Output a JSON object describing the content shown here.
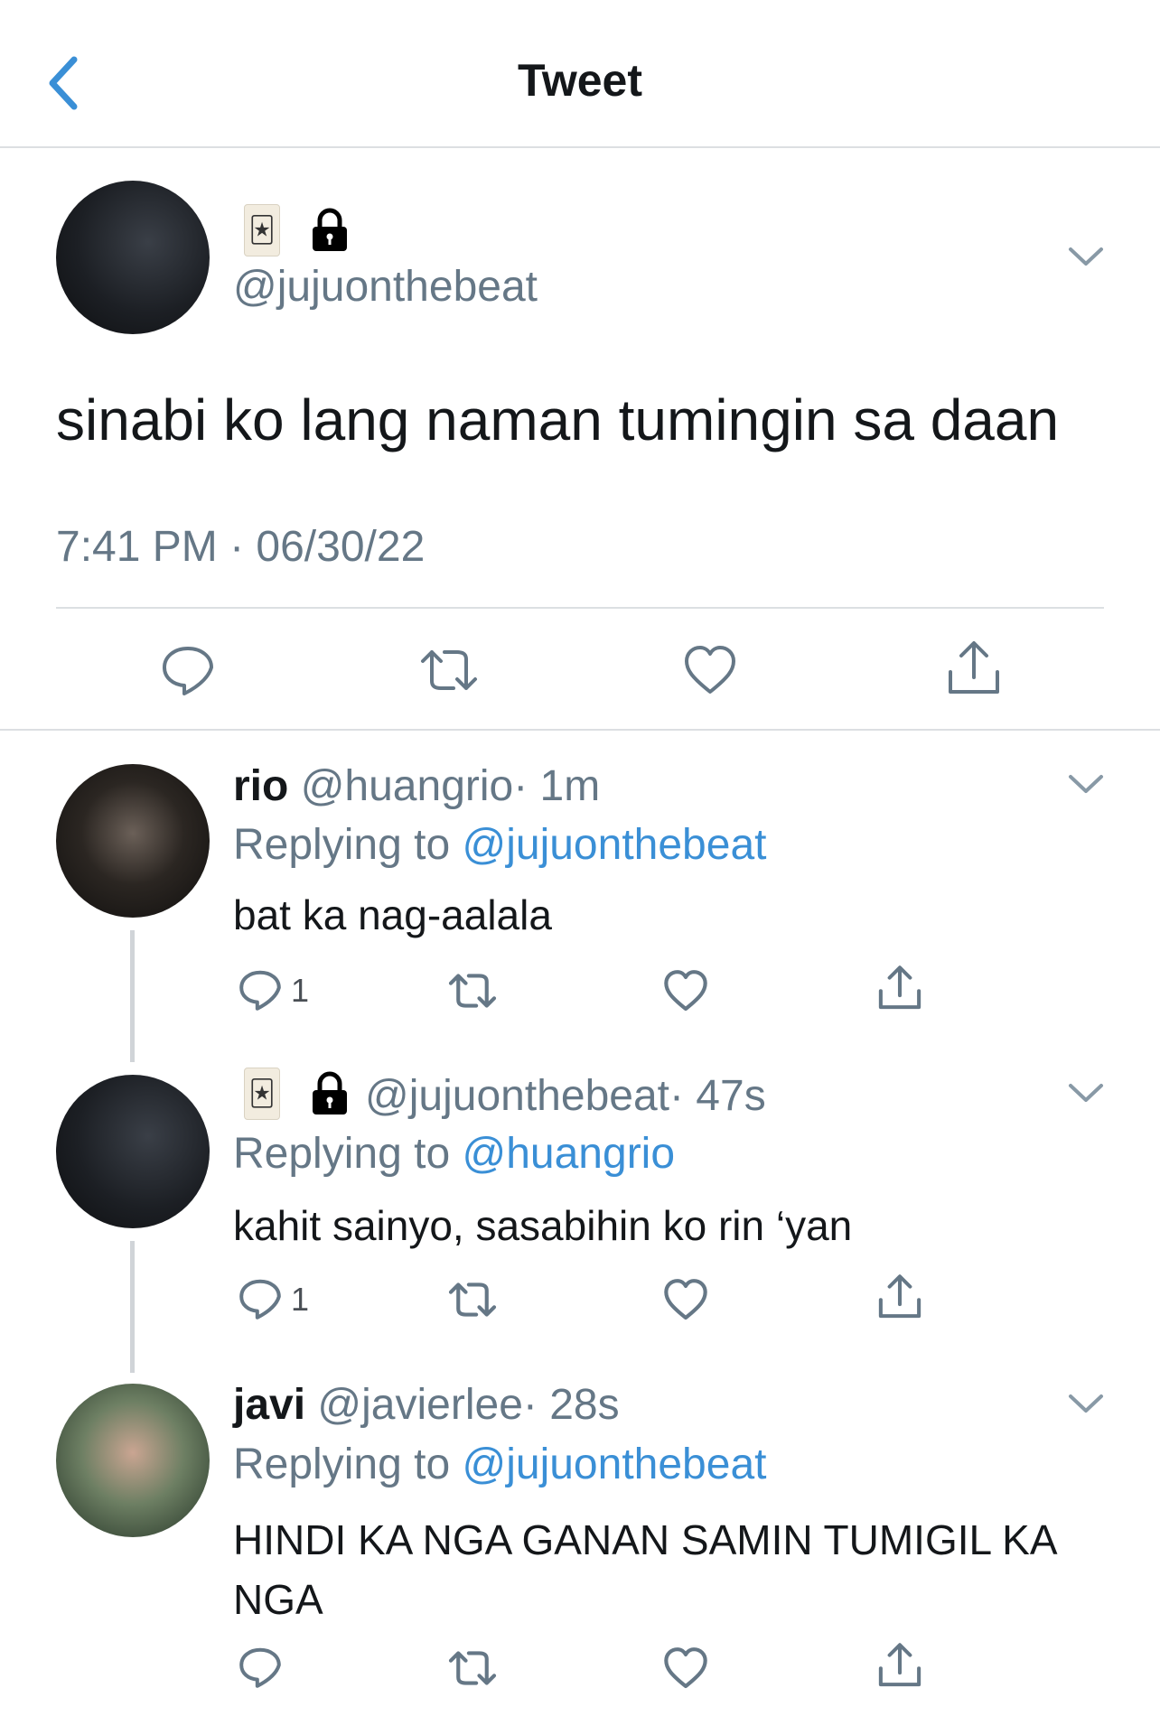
{
  "header": {
    "title": "Tweet"
  },
  "main_tweet": {
    "handle": "@jujuonthebeat",
    "text": "sinabi ko lang naman tumingin sa daan",
    "timestamp": "7:41 PM · 06/30/22"
  },
  "replies": [
    {
      "name": "rio",
      "handle": "@huangrio",
      "time": "· 1m",
      "replying_label": "Replying to",
      "replying_to": "@jujuonthebeat",
      "text": "bat ka nag-aalala",
      "reply_count": "1"
    },
    {
      "name": "",
      "handle": "@jujuonthebeat",
      "time": "· 47s",
      "replying_label": "Replying to",
      "replying_to": "@huangrio",
      "text": "kahit sainyo, sasabihin ko rin ‘yan",
      "reply_count": "1"
    },
    {
      "name": "javi",
      "handle": "@javierlee",
      "time": "· 28s",
      "replying_label": "Replying to",
      "replying_to": "@jujuonthebeat",
      "text": "HINDI KA NGA GANAN SAMIN TUMIGIL KA NGA",
      "reply_count": ""
    }
  ],
  "icons": {
    "card": "joker-card-icon",
    "lock": "lock-icon"
  },
  "colors": {
    "link": "#3a8fd6",
    "muted": "#657786",
    "divider": "#dcdfe2"
  }
}
